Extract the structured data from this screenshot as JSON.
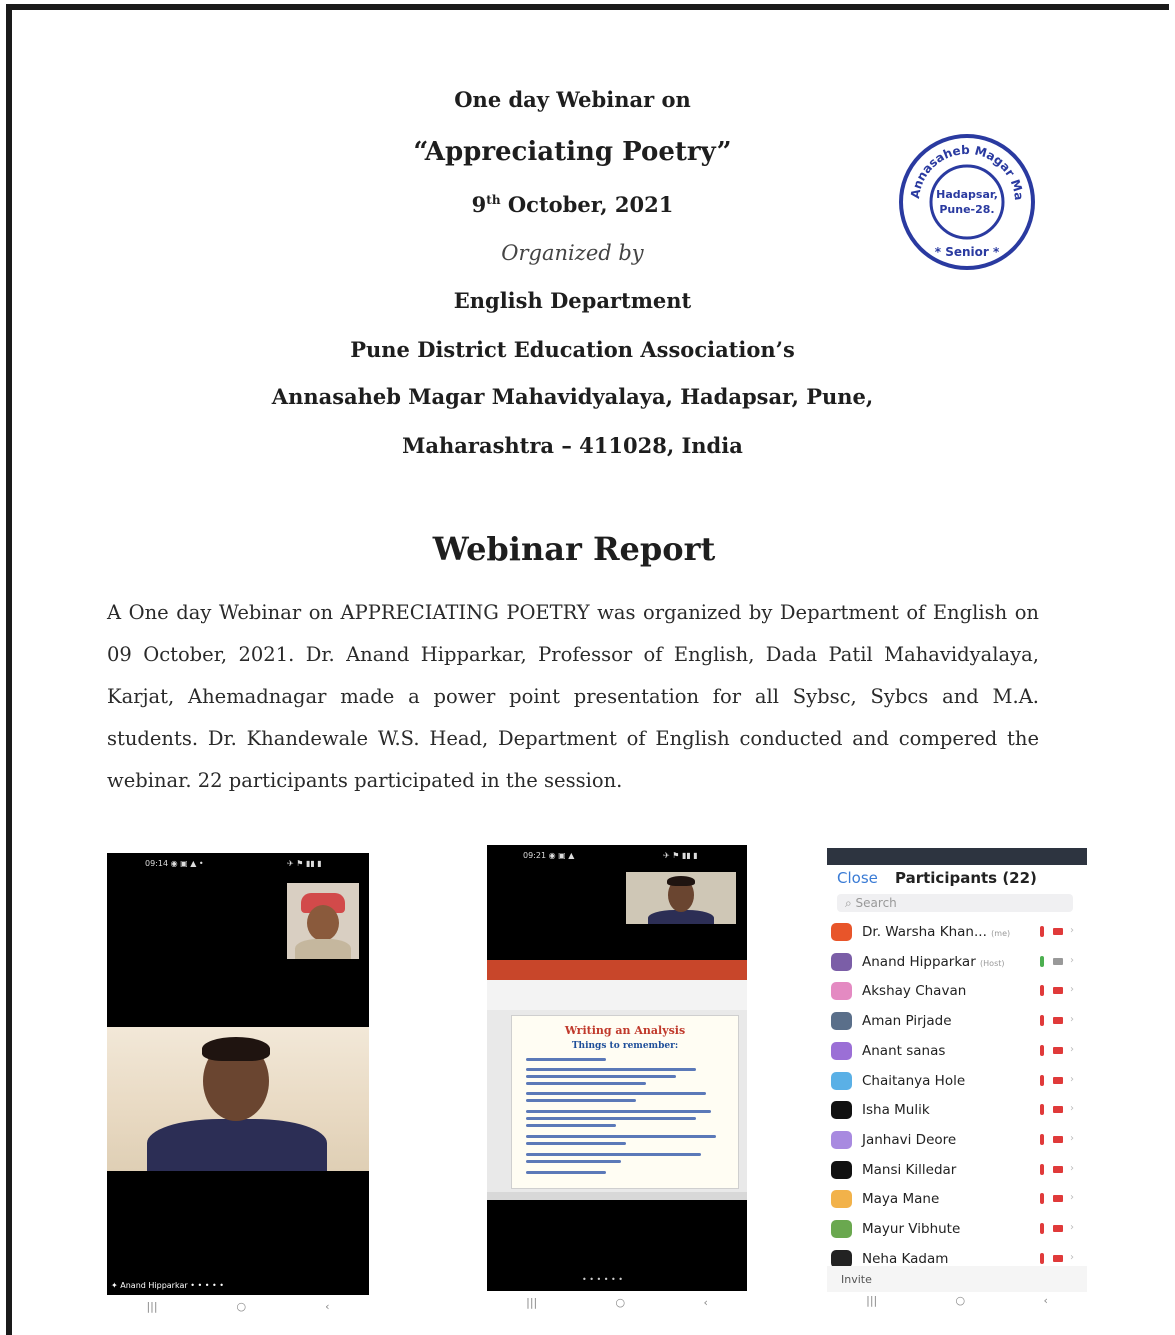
{
  "header": {
    "line1": "One day Webinar on",
    "line2": "“Appreciating Poetry”",
    "date_day": "9",
    "date_suffix": "th",
    "date_rest": " October, 2021",
    "organized_by": "Organized by",
    "department": "English Department",
    "association": "Pune District Education Association’s",
    "college": "Annasaheb Magar Mahavidyalaya, Hadapsar, Pune,",
    "address": "Maharashtra – 411028, India"
  },
  "seal": {
    "outer_text": "Annasaheb Magar Mahavidyalaya",
    "inner_line1": "Hadapsar,",
    "inner_line2": "Pune-28.",
    "bottom_text": "Senior",
    "color": "#2a3aa0"
  },
  "report": {
    "title": "Webinar Report",
    "body": "A One day Webinar on APPRECIATING POETRY  was organized by Department of English on 09 October, 2021.  Dr. Anand Hipparkar, Professor of English,  Dada Patil Mahavidyalaya, Karjat, Ahemadnagar made a power point presentation for all Sybsc, Sybcs and M.A. students. Dr. Khandewale W.S.  Head, Department of English conducted and compered the webinar. 22 participants participated in the session."
  },
  "screenshot1": {
    "caption": "Anand Hipparkar"
  },
  "screenshot2": {
    "slide_title": "Writing an Analysis",
    "slide_subtitle": "Things to remember:"
  },
  "screenshot3": {
    "close_label": "Close",
    "title": "Participants (22)",
    "search_placeholder": "Search",
    "invite_label": "Invite",
    "participants": [
      {
        "name": "Dr. Warsha Khan...",
        "tag": "(me)",
        "color": "#e8552a"
      },
      {
        "name": "Anand Hipparkar",
        "tag": "(Host)",
        "color": "#7b5ea7"
      },
      {
        "name": "Akshay Chavan",
        "tag": "",
        "color": "#e48ac2"
      },
      {
        "name": "Aman Pirjade",
        "tag": "",
        "color": "#5a6f8a"
      },
      {
        "name": "Anant sanas",
        "tag": "",
        "color": "#9b6fd6"
      },
      {
        "name": "Chaitanya Hole",
        "tag": "",
        "color": "#5ab0e6"
      },
      {
        "name": "Isha Mulik",
        "tag": "",
        "color": "#111111"
      },
      {
        "name": "Janhavi Deore",
        "tag": "",
        "color": "#a88ae0"
      },
      {
        "name": "Mansi Killedar",
        "tag": "",
        "color": "#111111"
      },
      {
        "name": "Maya Mane",
        "tag": "",
        "color": "#f2b24a"
      },
      {
        "name": "Mayur Vibhute",
        "tag": "",
        "color": "#6aa84f"
      },
      {
        "name": "Neha Kadam",
        "tag": "",
        "color": "#222222"
      }
    ]
  }
}
